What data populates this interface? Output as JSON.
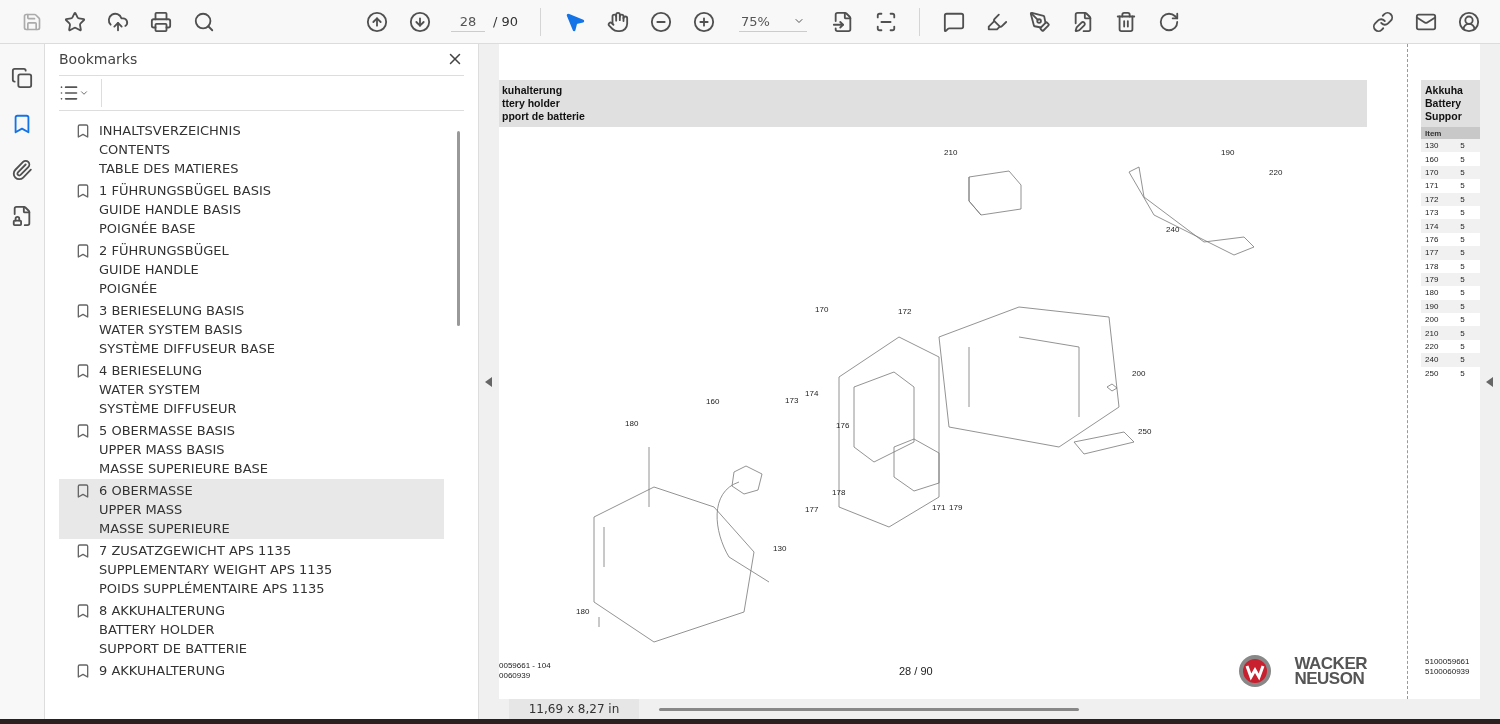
{
  "toolbar": {
    "page_input": {
      "value": "28"
    },
    "page_total": "/ 90",
    "zoom": {
      "value": "75%"
    },
    "tools": [
      {
        "selected": true
      },
      {
        "selected": false
      }
    ]
  },
  "rail": [
    {
      "selected": false
    },
    {
      "selected": true
    },
    {
      "selected": false
    },
    {
      "selected": false
    }
  ],
  "bookmarks": {
    "title": "Bookmarks",
    "items": [
      {
        "lines": [
          "INHALTSVERZEICHNIS",
          "CONTENTS",
          "TABLE DES MATIERES"
        ],
        "selected": false
      },
      {
        "lines": [
          "1 FÜHRUNGSBÜGEL BASIS",
          "GUIDE HANDLE BASIS",
          "POIGNÉE BASE"
        ],
        "selected": false
      },
      {
        "lines": [
          "2 FÜHRUNGSBÜGEL",
          "GUIDE HANDLE",
          "POIGNÉE"
        ],
        "selected": false
      },
      {
        "lines": [
          "3 BERIESELUNG BASIS",
          "WATER SYSTEM BASIS",
          "SYSTÈME DIFFUSEUR BASE"
        ],
        "selected": false
      },
      {
        "lines": [
          "4 BERIESELUNG",
          "WATER SYSTEM",
          "SYSTÈME DIFFUSEUR"
        ],
        "selected": false
      },
      {
        "lines": [
          "5 OBERMASSE BASIS",
          "UPPER MASS BASIS",
          "MASSE SUPERIEURE BASE"
        ],
        "selected": false
      },
      {
        "lines": [
          "6 OBERMASSE",
          "UPPER MASS",
          "MASSE SUPERIEURE"
        ],
        "selected": true
      },
      {
        "lines": [
          "7 ZUSATZGEWICHT APS 1135",
          "SUPPLEMENTARY WEIGHT APS 1135",
          "POIDS SUPPLÉMENTAIRE APS 1135"
        ],
        "selected": false
      },
      {
        "lines": [
          "8 AKKUHALTERUNG",
          "BATTERY HOLDER",
          "SUPPORT DE BATTERIE"
        ],
        "selected": false
      },
      {
        "lines": [
          "9 AKKUHALTERUNG"
        ],
        "selected": false
      }
    ]
  },
  "page": {
    "header": [
      "kuhalterung",
      "ttery holder",
      "pport de batterie"
    ],
    "callouts": [
      "210",
      "190",
      "220",
      "240",
      "170",
      "172",
      "200",
      "160",
      "174",
      "173",
      "176",
      "180",
      "171",
      "178",
      "179",
      "177",
      "130",
      "250",
      "180"
    ],
    "doc_numbers": [
      "0059661 - 104",
      "0060939"
    ],
    "page_number": "28 / 90",
    "logo": [
      "WACKER",
      "NEUSON"
    ]
  },
  "next_page": {
    "header": [
      "Akkuha",
      "Battery",
      "Suppor"
    ],
    "column_1": "Item",
    "rows": [
      [
        "130",
        "5"
      ],
      [
        "160",
        "5"
      ],
      [
        "170",
        "5"
      ],
      [
        "171",
        "5"
      ],
      [
        "172",
        "5"
      ],
      [
        "173",
        "5"
      ],
      [
        "174",
        "5"
      ],
      [
        "176",
        "5"
      ],
      [
        "177",
        "5"
      ],
      [
        "178",
        "5"
      ],
      [
        "179",
        "5"
      ],
      [
        "180",
        "5"
      ],
      [
        "190",
        "5"
      ],
      [
        "200",
        "5"
      ],
      [
        "210",
        "5"
      ],
      [
        "220",
        "5"
      ],
      [
        "240",
        "5"
      ],
      [
        "250",
        "5"
      ]
    ],
    "doc_numbers": [
      "5100059661",
      "5100060939"
    ]
  },
  "status_bar": {
    "page_size": "11,69 x 8,27 in"
  }
}
